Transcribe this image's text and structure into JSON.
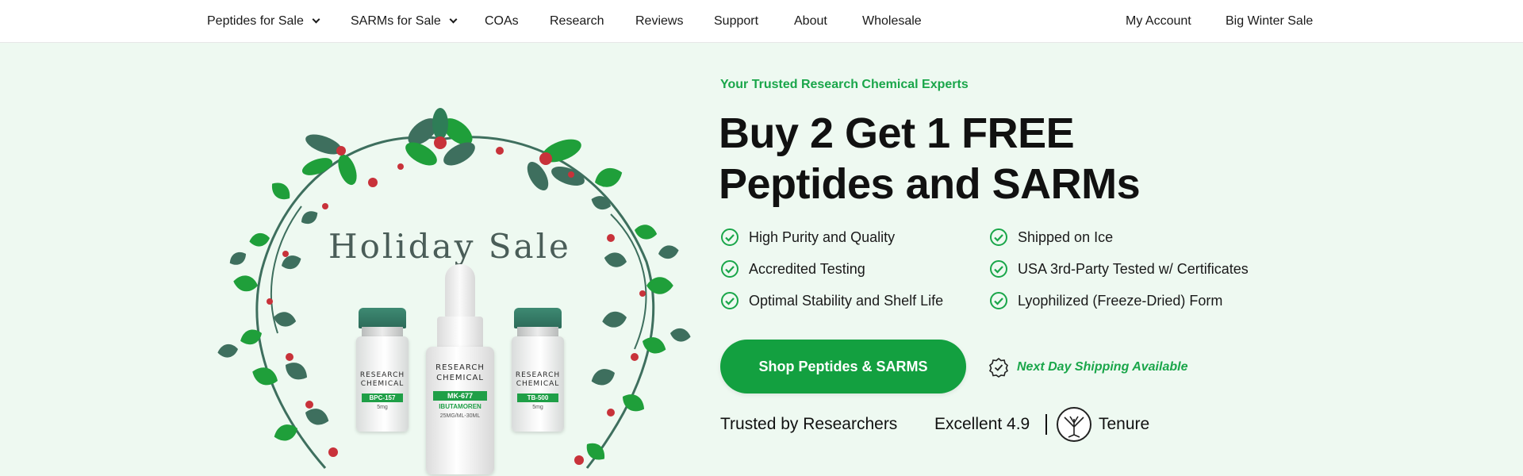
{
  "nav": {
    "left_items": [
      {
        "label": "Peptides for Sale",
        "has_dropdown": true
      },
      {
        "label": "SARMs for Sale",
        "has_dropdown": true
      },
      {
        "label": "COAs",
        "has_dropdown": false
      },
      {
        "label": "Research",
        "has_dropdown": false
      },
      {
        "label": "Reviews",
        "has_dropdown": false
      },
      {
        "label": "Support",
        "has_dropdown": false
      },
      {
        "label": "About",
        "has_dropdown": false
      },
      {
        "label": "Wholesale",
        "has_dropdown": false
      }
    ],
    "right_items": [
      {
        "label": "My Account"
      },
      {
        "label": "Big Winter Sale"
      }
    ]
  },
  "hero_image": {
    "title": "Holiday Sale",
    "vials": [
      {
        "brand": "RESEARCH\nCHEMICAL",
        "product": "BPC-157",
        "dose": "5mg"
      },
      {
        "brand": "RESEARCH\nCHEMICAL",
        "product": "MK-677",
        "sub": "IBUTAMOREN",
        "dose": "25MG/ML-30ML"
      },
      {
        "brand": "RESEARCH\nCHEMICAL",
        "product": "TB-500",
        "dose": "5mg"
      }
    ]
  },
  "hero": {
    "eyebrow": "Your Trusted Research Chemical Experts",
    "headline_line1": "Buy 2 Get 1 FREE",
    "headline_line2": "Peptides and SARMs",
    "features_left": [
      "High Purity and Quality",
      "Accredited Testing",
      "Optimal Stability and Shelf Life"
    ],
    "features_right": [
      "Shipped on Ice",
      "USA 3rd-Party Tested w/ Certificates",
      "Lyophilized (Freeze-Dried) Form"
    ],
    "cta_label": "Shop Peptides & SARMS",
    "shipping_note": "Next Day Shipping Available",
    "trusted_label": "Trusted by Researchers",
    "rating_label": "Excellent 4.9",
    "review_brand": "Tenure"
  },
  "colors": {
    "accent": "#13a040",
    "background": "#eef9f1",
    "leaf_dark": "#3e6f5e",
    "leaf_green": "#1f9f3a",
    "berry": "#c8323a"
  }
}
